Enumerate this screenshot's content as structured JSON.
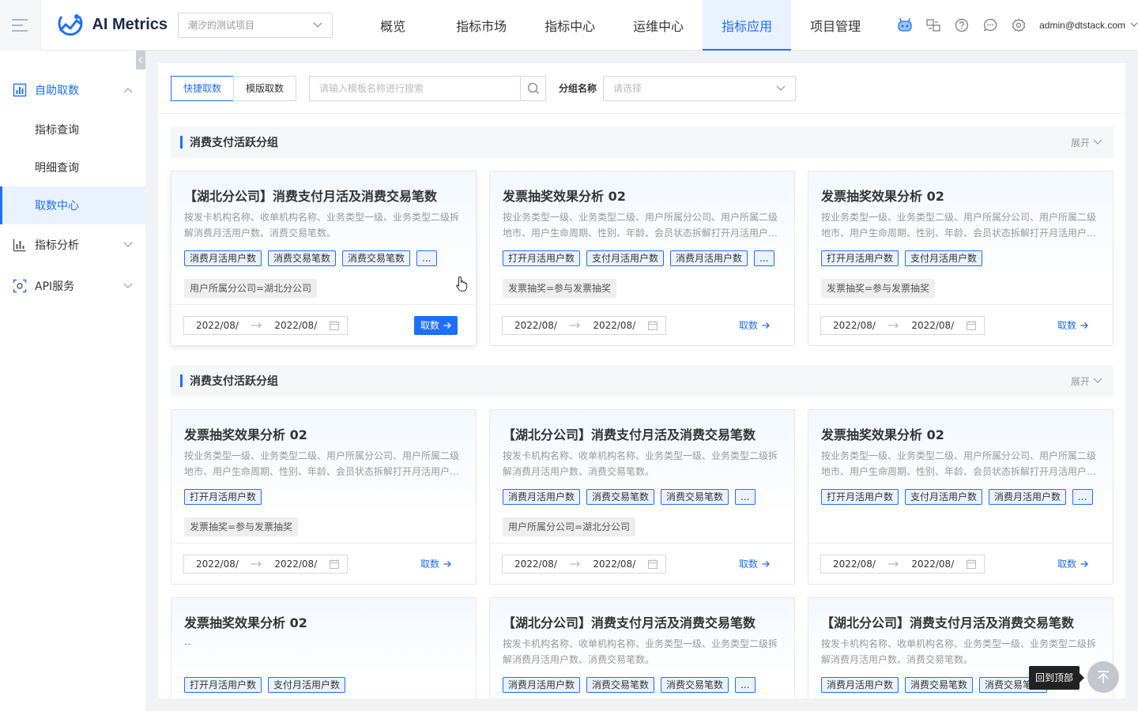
{
  "header": {
    "app_name": "AI Metrics",
    "project_select": "潮汐的测试项目",
    "nav": [
      "概览",
      "指标市场",
      "指标中心",
      "运维中心",
      "指标应用",
      "项目管理"
    ],
    "active_nav": 4,
    "user": "admin@dtstack.com",
    "icons": [
      "robot-icon",
      "translate-icon",
      "help-icon",
      "message-icon",
      "settings-icon"
    ]
  },
  "sidebar": {
    "groups": [
      {
        "label": "自助取数",
        "icon": "chart-bar-icon",
        "open": true,
        "children": [
          "指标查询",
          "明细查询",
          "取数中心"
        ],
        "active_child": 2
      },
      {
        "label": "指标分析",
        "icon": "analysis-icon",
        "open": false
      },
      {
        "label": "API服务",
        "icon": "api-icon",
        "open": false
      }
    ]
  },
  "toolbar": {
    "tabs": [
      "快捷取数",
      "模版取数"
    ],
    "active_tab": 0,
    "search_placeholder": "请输入模板名称进行搜索",
    "group_label": "分组名称",
    "group_placeholder": "请选择"
  },
  "groups": [
    {
      "title": "消费支付活跃分组",
      "expand_label": "展开"
    },
    {
      "title": "消费支付活跃分组",
      "expand_label": "展开"
    }
  ],
  "common": {
    "date_start": "2022/08/",
    "date_end": "2022/08/",
    "fetch_label": "取数",
    "more_tag": "..."
  },
  "cards": [
    {
      "title": "【湖北分公司】消费支付月活及消费交易笔数",
      "desc": "按发卡机构名称、收单机构名称、业务类型一级、业务类型二级拆解消费月活用户数、消费交易笔数。",
      "tags": [
        "消费月活用户数",
        "消费交易笔数",
        "消费交易笔数",
        "..."
      ],
      "filter": "用户所属分公司=湖北分公司"
    },
    {
      "title": "发票抽奖效果分析 02",
      "desc": "按业务类型一级、业务类型二级、用户所属分公司、用户所属二级地市、用户生命周期、性别、年龄、会员状态拆解打开月活用户数、支付月活用户数。",
      "tags": [
        "打开月活用户数",
        "支付月活用户数",
        "消费月活用户数",
        "..."
      ],
      "filter": "发票抽奖=参与发票抽奖"
    },
    {
      "title": "发票抽奖效果分析 02",
      "desc": "按业务类型一级、业务类型二级、用户所属分公司、用户所属二级地市、用户生命周期、性别、年龄、会员状态拆解打开月活用户数、支付月活用户数。",
      "tags": [
        "打开月活用户数",
        "支付月活用户数"
      ],
      "filter": "发票抽奖=参与发票抽奖"
    },
    {
      "title": "发票抽奖效果分析 02",
      "desc": "按业务类型一级、业务类型二级、用户所属分公司、用户所属二级地市、用户生命周期、性别、年龄、会员状态拆解打开月活用户数、支付月活用户数。",
      "tags": [
        "打开月活用户数"
      ],
      "filter": "发票抽奖=参与发票抽奖"
    },
    {
      "title": "【湖北分公司】消费支付月活及消费交易笔数",
      "desc": "按发卡机构名称、收单机构名称、业务类型一级、业务类型二级拆解消费月活用户数、消费交易笔数。",
      "tags": [
        "消费月活用户数",
        "消费交易笔数",
        "消费交易笔数",
        "..."
      ],
      "filter": "用户所属分公司=湖北分公司"
    },
    {
      "title": "发票抽奖效果分析 02",
      "desc": "按业务类型一级、业务类型二级、用户所属分公司、用户所属二级地市、用户生命周期、性别、年龄、会员状态拆解打开月活用户数、支付月活用户数。",
      "tags": [
        "打开月活用户数",
        "支付月活用户数",
        "消费月活用户数",
        "..."
      ],
      "filter": ""
    },
    {
      "title": "发票抽奖效果分析 02",
      "desc": "--",
      "tags": [
        "打开月活用户数",
        "支付月活用户数"
      ],
      "filter": ""
    },
    {
      "title": "【湖北分公司】消费支付月活及消费交易笔数",
      "desc": "按发卡机构名称、收单机构名称、业务类型一级、业务类型二级拆解消费月活用户数、消费交易笔数。",
      "tags": [
        "消费月活用户数",
        "消费交易笔数",
        "消费交易笔数",
        "..."
      ],
      "filter": ""
    },
    {
      "title": "【湖北分公司】消费支付月活及消费交易笔数",
      "desc": "按发卡机构名称、收单机构名称、业务类型一级、业务类型二级拆解消费月活用户数、消费交易笔数。",
      "tags": [
        "消费月活用户数",
        "消费交易笔数",
        "消费交易笔数"
      ],
      "filter": ""
    }
  ],
  "back_to_top": "回到顶部"
}
